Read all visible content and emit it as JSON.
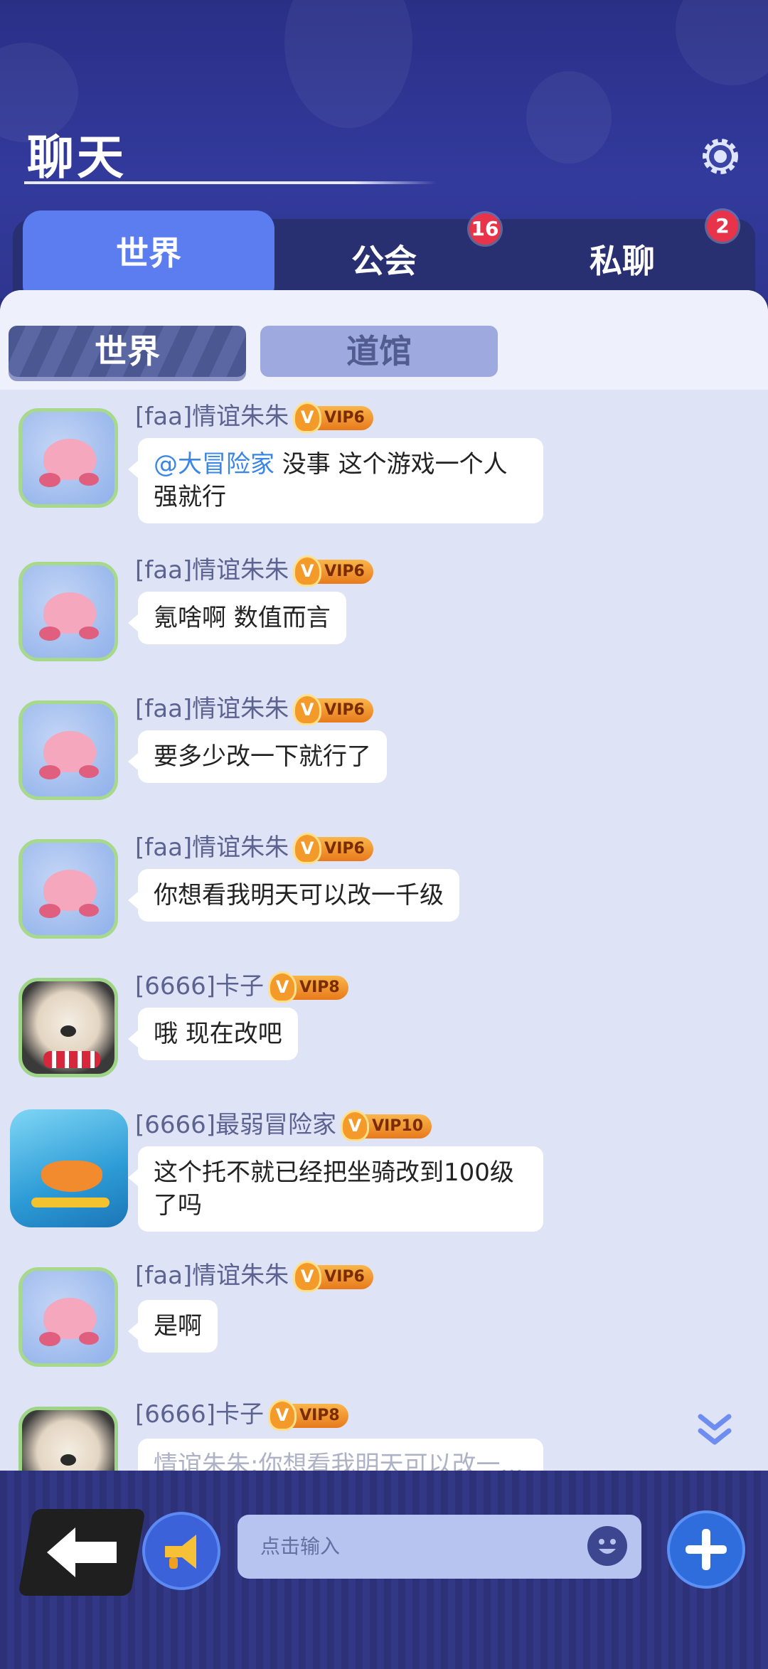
{
  "header": {
    "title": "聊天"
  },
  "tabs": [
    {
      "label": "世界",
      "badge": ""
    },
    {
      "label": "公会",
      "badge": "16"
    },
    {
      "label": "私聊",
      "badge": "2"
    }
  ],
  "subtabs": [
    {
      "label": "世界"
    },
    {
      "label": "道馆"
    }
  ],
  "messages": [
    {
      "name": "[faa]情谊朱朱",
      "vip": "VIP6",
      "mention": "@大冒险家",
      "text": " 没事 这个游戏一个人强就行"
    },
    {
      "name": "[faa]情谊朱朱",
      "vip": "VIP6",
      "text": "氪啥啊 数值而言"
    },
    {
      "name": "[faa]情谊朱朱",
      "vip": "VIP6",
      "text": "要多少改一下就行了"
    },
    {
      "name": "[faa]情谊朱朱",
      "vip": "VIP6",
      "text": "你想看我明天可以改一千级"
    },
    {
      "name": "[6666]卡子",
      "vip": "VIP8",
      "text": "哦 现在改吧"
    },
    {
      "name": "[6666]最弱冒险家",
      "vip": "VIP10",
      "text": "这个托不就已经把坐骑改到100级了吗"
    },
    {
      "name": "[faa]情谊朱朱",
      "vip": "VIP6",
      "text": "是啊"
    },
    {
      "name": "[6666]卡子",
      "vip": "VIP8",
      "text": "情谊朱朱:你想看我明天可以改一..."
    }
  ],
  "input": {
    "placeholder": "点击输入"
  },
  "icons": {
    "settings": "gear-icon",
    "scroll": "double-chevron-down-icon",
    "back": "back-arrow-icon",
    "horn": "megaphone-icon",
    "emoji": "smiley-icon",
    "add": "plus-icon"
  },
  "colors": {
    "accent": "#5b7df0",
    "badge": "#e8344b",
    "mention": "#3a86e6"
  }
}
